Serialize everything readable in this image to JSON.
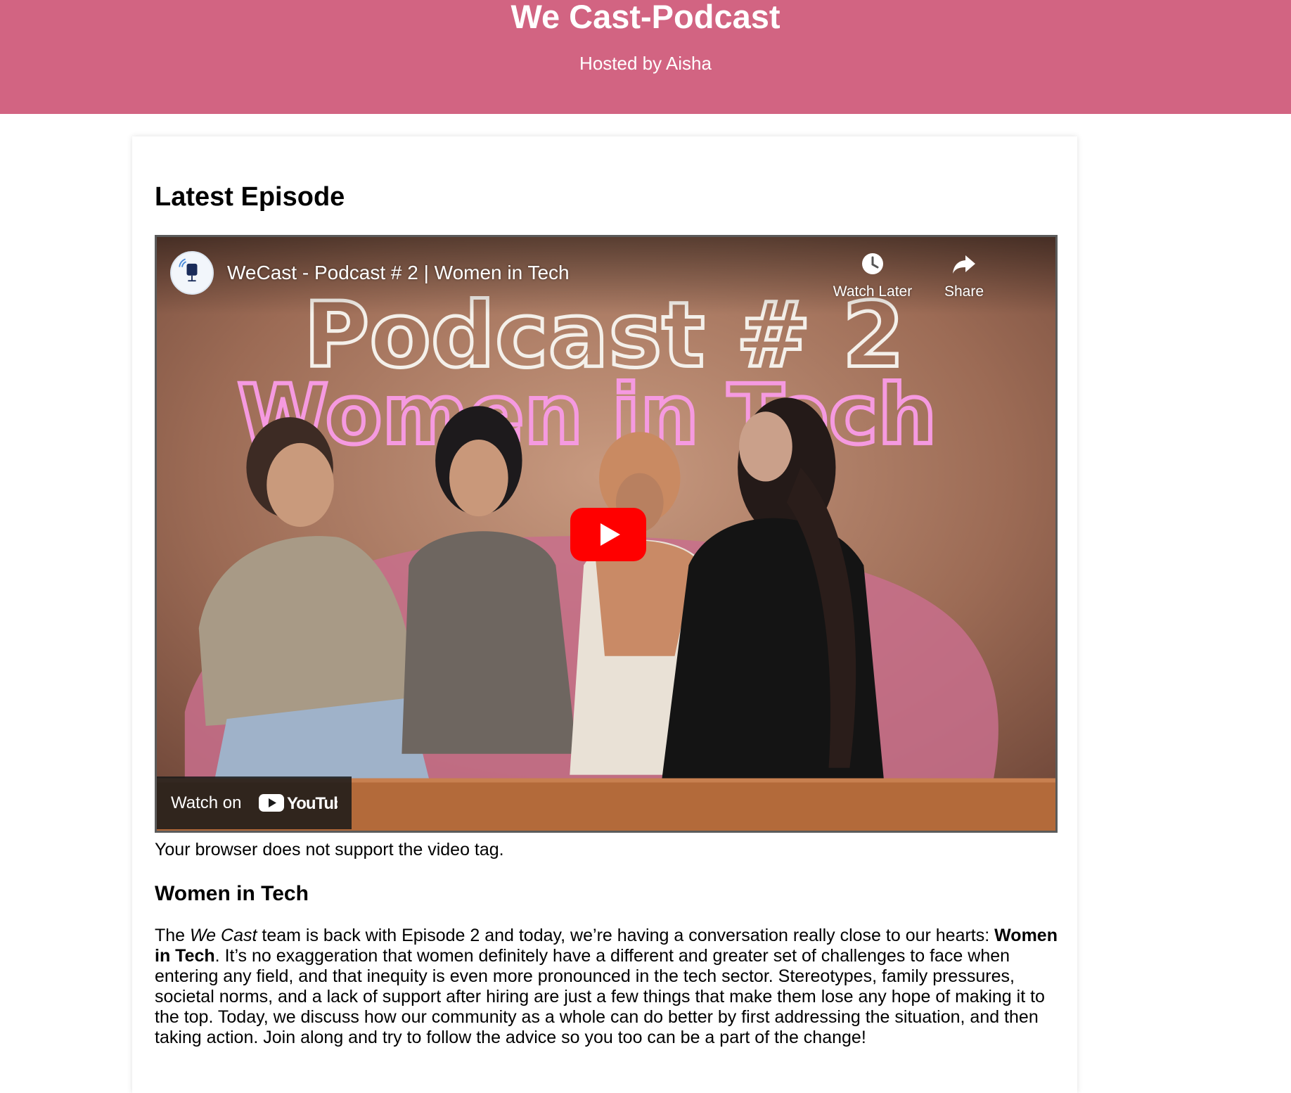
{
  "header": {
    "title": "We Cast-Podcast",
    "host": "Hosted by Aisha",
    "background_color": "#d26482"
  },
  "main": {
    "section_title": "Latest Episode",
    "video": {
      "title": "WeCast - Podcast # 2 | Women in Tech",
      "thumbnail_text_line1": "Podcast # 2",
      "thumbnail_text_line2": "Women in Tech",
      "watch_later_label": "Watch Later",
      "share_label": "Share",
      "watch_on_label": "Watch on",
      "youtube_label": "YouTube",
      "channel_avatar_icon": "wecast-logo-icon",
      "play_icon": "play-icon"
    },
    "fallback_text": "Your browser does not support the video tag.",
    "episode": {
      "title": "Women in Tech",
      "desc_intro": "The ",
      "desc_brand": "We Cast",
      "desc_part2": " team is back with Episode 2 and today, we’re having a conversation really close to our hearts: ",
      "desc_topic": "Women in Tech",
      "desc_part3": ". It’s no exaggeration that women definitely have a different and greater set of challenges to face when entering any field, and that inequity is even more pronounced in the tech sector. Stereotypes, family pressures, societal norms, and a lack of support after hiring are just a few things that make them lose any hope of making it to the top. Today, we discuss how our community as a whole can do better by first addressing the situation, and then taking action. Join along and try to follow the advice so you too can be a part of the change!"
    }
  }
}
